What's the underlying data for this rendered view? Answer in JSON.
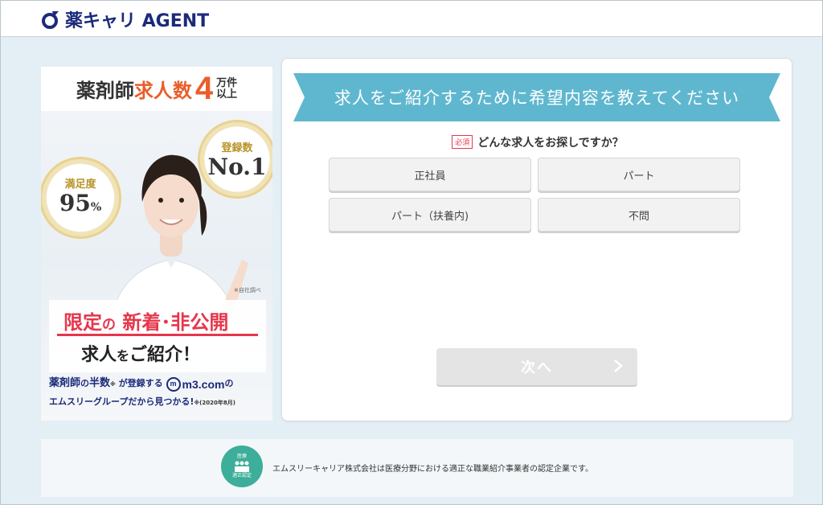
{
  "header": {
    "logo_text": "薬キャリ AGENT"
  },
  "banner": {
    "top_a": "薬剤師",
    "top_b": "求人数",
    "top_num": "4",
    "top_unit_1": "万件",
    "top_unit_2": "以上",
    "medal_satisfaction_label": "満足度",
    "medal_satisfaction_value": "95",
    "medal_satisfaction_unit": "%",
    "medal_reg_label": "登録数",
    "medal_reg_value": "No.1",
    "note_self": "※自社調べ",
    "limited_1a": "限定",
    "limited_1b": "の",
    "limited_1c": " 新着･非公開",
    "limited_2a": "求人",
    "limited_2b": "を",
    "limited_2c": "ご紹介！",
    "foot_1a": "薬剤師",
    "foot_1b": "の",
    "foot_1c": "半数",
    "foot_1d": "が登録する",
    "foot_m3": "m3.com",
    "foot_1e": "の",
    "foot_2": "エムスリーグループだから見つかる!",
    "foot_2_note": "※(2020年8月)"
  },
  "panel": {
    "ribbon_title": "求人をご紹介するために希望内容を教えてください",
    "required_tag": "必須",
    "question": "どんな求人をお探しですか？",
    "options": [
      {
        "label": "正社員"
      },
      {
        "label": "パート"
      },
      {
        "label": "パート（扶養内)"
      },
      {
        "label": "不問"
      }
    ],
    "next_label": "次へ"
  },
  "footer": {
    "cert_line_1": "医療",
    "cert_line_2": "適正認定",
    "text": "エムスリーキャリア株式会社は医療分野における適正な職業紹介事業者の認定企業です。"
  },
  "colors": {
    "ribbon": "#5fb7cf",
    "accent_red": "#e5374c",
    "accent_orange": "#e95e2b",
    "brand_navy": "#1b2a7a",
    "cert_green": "#3cae9a"
  }
}
